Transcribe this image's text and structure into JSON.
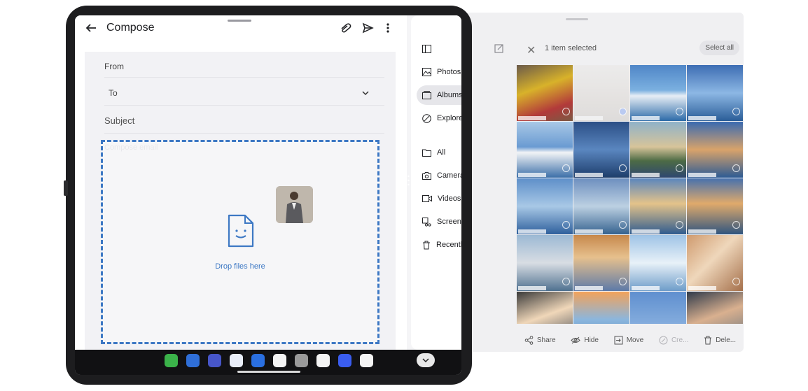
{
  "compose": {
    "title": "Compose",
    "from_label": "From",
    "to_label": "To",
    "subject_placeholder": "Subject",
    "body_placeholder": "Compose email",
    "drop_text": "Drop files here",
    "icons": [
      "back-arrow-icon",
      "paperclip-icon",
      "send-icon",
      "more-vert-icon",
      "chevron-down-icon",
      "file-icon"
    ]
  },
  "side_pane": {
    "items": [
      {
        "label": "",
        "icon": "sidebar-toggle-icon"
      },
      {
        "label": "Photos",
        "icon": "photo-icon"
      },
      {
        "label": "Albums",
        "icon": "album-icon",
        "active": true
      },
      {
        "label": "Explore",
        "icon": "explore-icon"
      },
      {
        "label": "All",
        "icon": "folder-icon"
      },
      {
        "label": "Camera",
        "icon": "camera-icon"
      },
      {
        "label": "Videos",
        "icon": "video-icon"
      },
      {
        "label": "Screenshots",
        "icon": "screenshot-icon"
      },
      {
        "label": "Recently deleted",
        "icon": "trash-icon"
      }
    ]
  },
  "gallery": {
    "selection_text": "1 item selected",
    "select_all_label": "Select all",
    "actions": [
      {
        "label": "Share",
        "icon": "share-icon",
        "enabled": true
      },
      {
        "label": "Hide",
        "icon": "hide-icon",
        "enabled": true
      },
      {
        "label": "Move",
        "icon": "move-icon",
        "enabled": true
      },
      {
        "label": "Cre...",
        "icon": "create-icon",
        "enabled": false
      },
      {
        "label": "Dele...",
        "icon": "delete-icon",
        "enabled": true
      }
    ],
    "selected_index": 1
  },
  "taskbar": {
    "apps": [
      {
        "name": "apps-grid-icon",
        "color": "#3bb34a"
      },
      {
        "name": "search-app-icon",
        "color": "#2f6fd8"
      },
      {
        "name": "screen-app-icon",
        "color": "#4756c9"
      },
      {
        "name": "phone-app-icon",
        "color": "#e9eef8"
      },
      {
        "name": "messages-app-icon",
        "color": "#2a6fe0"
      },
      {
        "name": "chrome-app-icon",
        "color": "#f4f4f4"
      },
      {
        "name": "camera-app-icon",
        "color": "#9a9a9a"
      },
      {
        "name": "gmail-app-icon",
        "color": "#f4f4f4"
      },
      {
        "name": "ai-app-icon",
        "color": "#3a5df0"
      },
      {
        "name": "drive-app-icon",
        "color": "#f4f4f4"
      }
    ]
  },
  "colors": {
    "accent": "#3d78c4",
    "selection": "#7b9ef0"
  }
}
